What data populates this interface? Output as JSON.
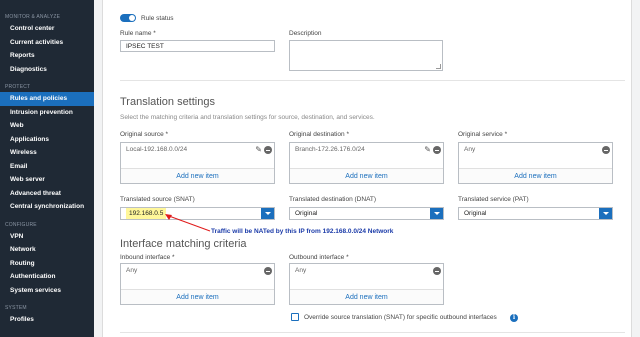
{
  "sidebar": {
    "sections": [
      {
        "title": "MONITOR & ANALYZE",
        "items": [
          "Control center",
          "Current activities",
          "Reports",
          "Diagnostics"
        ]
      },
      {
        "title": "PROTECT",
        "items": [
          "Rules and policies",
          "Intrusion prevention",
          "Web",
          "Applications",
          "Wireless",
          "Email",
          "Web server",
          "Advanced threat",
          "Central synchronization"
        ],
        "active": "Rules and policies"
      },
      {
        "title": "CONFIGURE",
        "items": [
          "VPN",
          "Network",
          "Routing",
          "Authentication",
          "System services"
        ]
      },
      {
        "title": "SYSTEM",
        "items": [
          "Profiles"
        ]
      }
    ]
  },
  "rule_status": {
    "label": "Rule status",
    "enabled": true
  },
  "rule_name": {
    "label": "Rule name *",
    "value": "IPSEC TEST"
  },
  "description": {
    "label": "Description",
    "value": ""
  },
  "translation": {
    "title": "Translation settings",
    "subtitle": "Select the matching criteria and translation settings for source, destination, and services.",
    "original_source": {
      "label": "Original source *",
      "entry": "Local-192.168.0.0/24",
      "add": "Add new item"
    },
    "original_destination": {
      "label": "Original destination *",
      "entry": "Branch-172.26.176.0/24",
      "add": "Add new item"
    },
    "original_service": {
      "label": "Original service *",
      "entry": "Any",
      "add": "Add new item"
    },
    "translated_source": {
      "label": "Translated source (SNAT)",
      "value": "192.168.0.5"
    },
    "translated_destination": {
      "label": "Translated destination (DNAT)",
      "value": "Original"
    },
    "translated_service": {
      "label": "Translated service (PAT)",
      "value": "Original"
    },
    "annotation": "Traffic will be NATed by this IP from 192.168.0.0/24 Network",
    "annotation_color": "#1a3aa8",
    "highlight_color": "#fff79a"
  },
  "interface": {
    "title": "Interface matching criteria",
    "inbound": {
      "label": "Inbound interface *",
      "entry": "Any",
      "add": "Add new item"
    },
    "outbound": {
      "label": "Outbound interface *",
      "entry": "Any",
      "add": "Add new item"
    },
    "override_label": "Override source translation (SNAT) for specific outbound interfaces",
    "override_checked": false
  },
  "colors": {
    "accent": "#1b6fbd",
    "sidebar_bg": "#1f2935"
  }
}
